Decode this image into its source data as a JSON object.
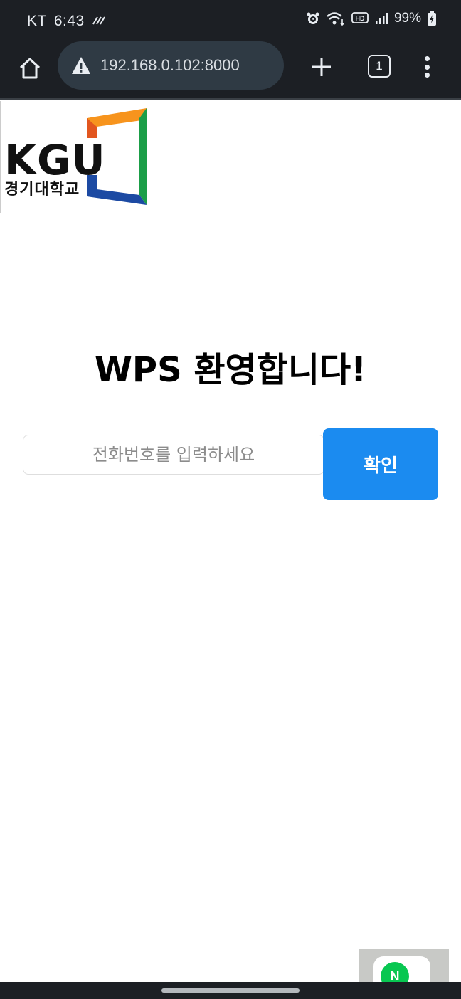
{
  "status_bar": {
    "carrier": "KT",
    "time": "6:43",
    "battery": "99%",
    "icons": [
      "signal-strength-icon",
      "alarm-icon",
      "wifi-icon",
      "hd-icon",
      "cellular-icon",
      "battery-icon"
    ]
  },
  "browser": {
    "url": "192.168.0.102:8000",
    "tab_count": "1",
    "icons": [
      "home-icon",
      "warning-icon",
      "plus-icon",
      "tabs-icon",
      "more-vert-icon"
    ]
  },
  "logo": {
    "text": "KGU",
    "subtitle": "경기대학교",
    "colors": [
      "#f7941d",
      "#1b9e48",
      "#1c4aa3"
    ]
  },
  "main": {
    "title": "WPS 환영합니다!",
    "phone_placeholder": "전화번호를 입력하세요",
    "confirm_label": "확인",
    "accent_color": "#1b8bf0"
  },
  "bottom": {
    "widget_letter": "N"
  }
}
